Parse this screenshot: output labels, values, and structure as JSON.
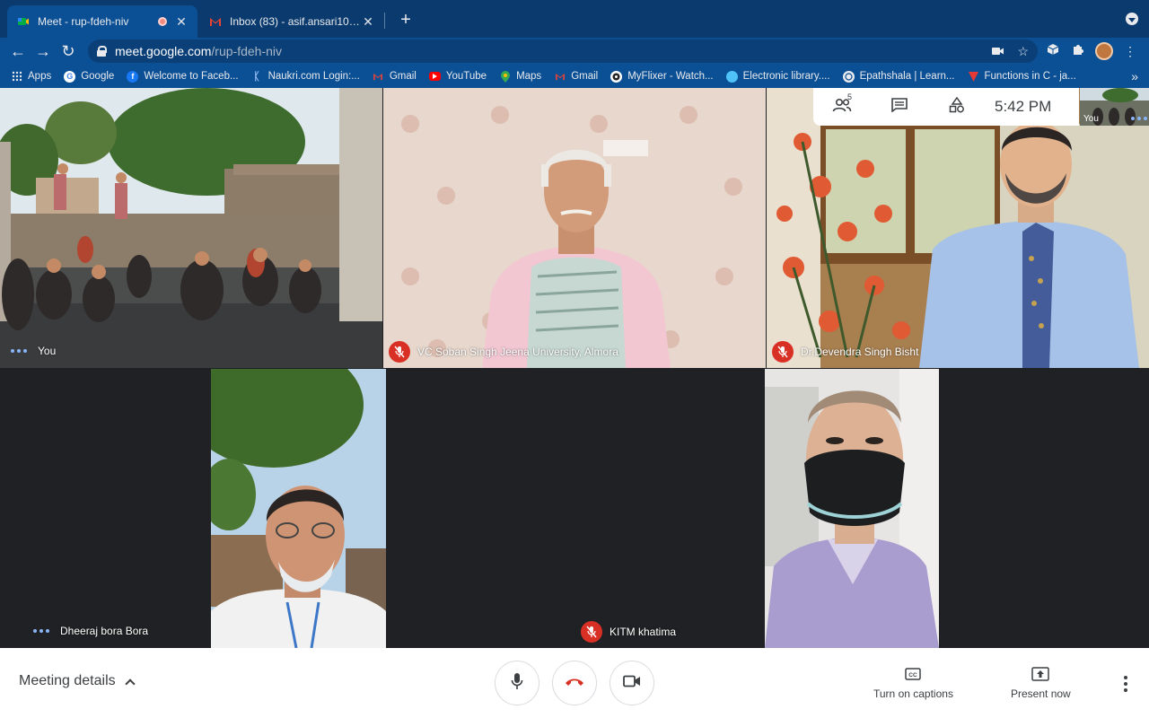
{
  "browser": {
    "tabs": [
      {
        "title": "Meet - rup-fdeh-niv",
        "active": true,
        "recording": true
      },
      {
        "title": "Inbox (83) - asif.ansari108@gm",
        "active": false
      }
    ],
    "url_domain": "meet.google.com",
    "url_path": "/rup-fdeh-niv",
    "bookmarks": [
      {
        "label": "Apps",
        "icon": "apps-grid-icon",
        "color": "#e8eaed"
      },
      {
        "label": "Google",
        "icon": "google-icon",
        "color": "#ffffff"
      },
      {
        "label": "Welcome to Faceb...",
        "icon": "facebook-icon",
        "color": "#1877f2"
      },
      {
        "label": "Naukri.com Login:...",
        "icon": "naukri-icon",
        "color": "#4a90e2"
      },
      {
        "label": "Gmail",
        "icon": "gmail-icon",
        "color": "#ea4335"
      },
      {
        "label": "YouTube",
        "icon": "youtube-icon",
        "color": "#ff0000"
      },
      {
        "label": "Maps",
        "icon": "maps-icon",
        "color": "#34a853"
      },
      {
        "label": "Gmail",
        "icon": "gmail-icon",
        "color": "#ea4335"
      },
      {
        "label": "MyFlixer - Watch...",
        "icon": "myflixer-icon",
        "color": "#ffffff"
      },
      {
        "label": "Electronic library....",
        "icon": "library-icon",
        "color": "#4fc3f7"
      },
      {
        "label": "Epathshala | Learn...",
        "icon": "epathshala-icon",
        "color": "#e8eaed"
      },
      {
        "label": "Functions in C - ja...",
        "icon": "functions-icon",
        "color": "#e53935"
      }
    ]
  },
  "meet": {
    "participant_count": "5",
    "clock": "5:42  PM",
    "self_thumb_label": "You",
    "participants": [
      {
        "name": "You",
        "muted": false
      },
      {
        "name": "VC Soban Singh Jeena University, Almora",
        "muted": true
      },
      {
        "name": "Dr.Devendra Singh Bisht",
        "muted": true
      },
      {
        "name": "Dheeraj bora Bora",
        "muted": false
      },
      {
        "name": "KITM khatima",
        "muted": true
      }
    ],
    "controls": {
      "meeting_details": "Meeting details",
      "captions": "Turn on captions",
      "present": "Present now"
    }
  }
}
